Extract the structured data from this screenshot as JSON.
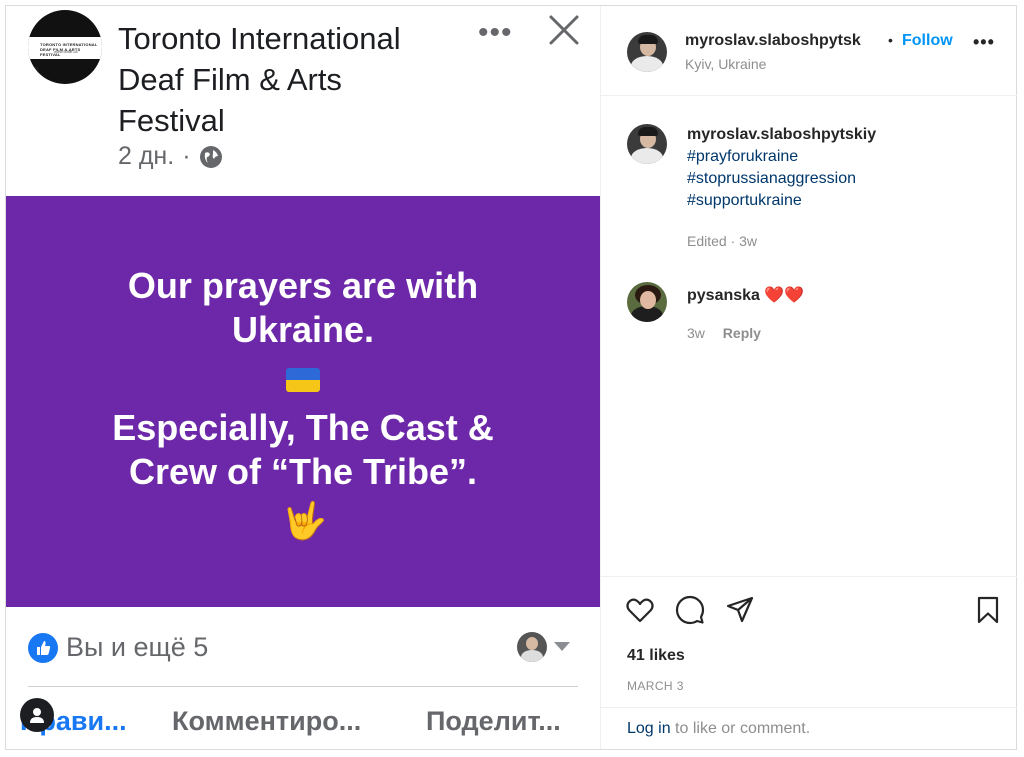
{
  "left": {
    "page_name": "Toronto International Deaf Film & Arts Festival",
    "logo_text_1": "TORONTO INTERNATIONAL DEAF FILM & ARTS FESTIVAL",
    "logo_text_2": "www.tidfaf.ca",
    "post_age": "2 дн.",
    "post_age_sep": "·",
    "more_label": "•••",
    "image_text_line1": "Our prayers are with Ukraine.",
    "image_text_line2": "Especially, The Cast & Crew of “The Tribe”.",
    "hand_emoji": "🤟",
    "reactions": "Вы и ещё 5",
    "action_like": "Прави...",
    "action_comment": "Комментиро...",
    "action_share": "Поделит..."
  },
  "header": {
    "username": "myroslav.slaboshpytsk",
    "separator": "•",
    "follow": "Follow",
    "location": "Kyiv, Ukraine",
    "more": "•••"
  },
  "caption": {
    "username": "myroslav.slaboshpytskiy",
    "tags": [
      "#prayforukraine",
      "#stoprussianaggression",
      "#supportukraine"
    ],
    "edited": "Edited · 3w"
  },
  "comments": [
    {
      "username": "pysanska",
      "text": "❤️❤️",
      "age": "3w",
      "reply": "Reply"
    }
  ],
  "actions": {
    "likes": "41 likes",
    "date": "MARCH 3",
    "login_link": "Log in",
    "login_text": " to like or comment."
  },
  "icons": [
    "globe-icon",
    "close-icon",
    "like-icon",
    "heart-icon",
    "comment-icon",
    "share-icon",
    "bookmark-icon",
    "user-icon"
  ],
  "colors": {
    "purple": "#6c28a8",
    "fb_blue": "#1877f2",
    "ig_blue": "#0095f6",
    "ig_link": "#00376b"
  }
}
